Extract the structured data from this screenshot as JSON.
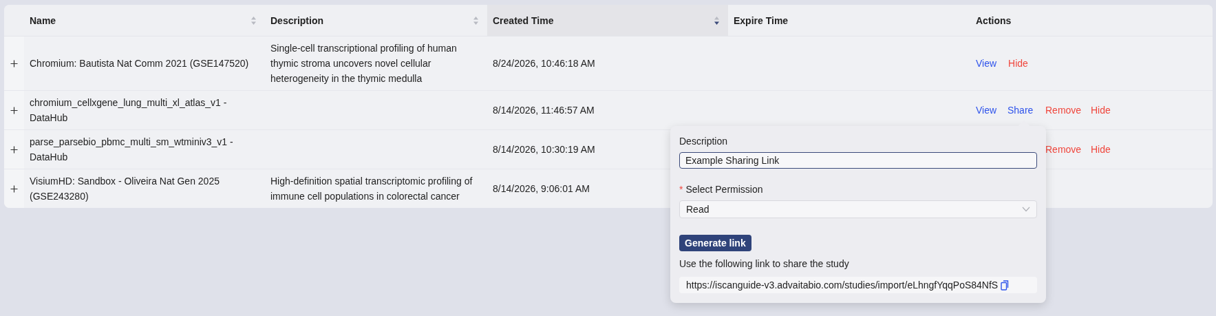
{
  "table": {
    "columns": [
      {
        "label": "Name",
        "sortable": true,
        "sorted": false
      },
      {
        "label": "Description",
        "sortable": true,
        "sorted": false
      },
      {
        "label": "Created Time",
        "sortable": true,
        "sorted": true
      },
      {
        "label": "Expire Time",
        "sortable": false,
        "sorted": false
      },
      {
        "label": "Actions",
        "sortable": false,
        "sorted": false
      }
    ],
    "rows": [
      {
        "name": "Chromium: Bautista Nat Comm 2021 (GSE147520)",
        "description": "Single-cell transcriptional profiling of human thymic stroma uncovers novel cellular heterogeneity in the thymic medulla",
        "created_time": "8/24/2026, 10:46:18 AM",
        "actions": [
          {
            "label": "View",
            "kind": "view"
          },
          {
            "label": "Hide",
            "kind": "hide"
          }
        ]
      },
      {
        "name": "chromium_cellxgene_lung_multi_xl_atlas_v1 - DataHub",
        "created_time": "8/14/2026, 11:46:57 AM",
        "actions": [
          {
            "label": "View",
            "kind": "view"
          },
          {
            "label": "Share",
            "kind": "share"
          },
          {
            "label": "Remove",
            "kind": "remove"
          },
          {
            "label": "Hide",
            "kind": "hide"
          }
        ]
      },
      {
        "name": "parse_parsebio_pbmc_multi_sm_wtminiv3_v1 - DataHub",
        "created_time": "8/14/2026, 10:30:19 AM",
        "actions": [
          {
            "label": "Remove",
            "kind": "remove"
          },
          {
            "label": "Hide",
            "kind": "hide"
          }
        ]
      },
      {
        "name": "VisiumHD: Sandbox - Oliveira Nat Gen 2025 (GSE243280)",
        "description": "High-definition spatial transcriptomic profiling of immune cell populations in colorectal cancer",
        "created_time": "8/14/2026, 9:06:01 AM",
        "actions": []
      }
    ]
  },
  "share_popover": {
    "description_label": "Description",
    "description_value": "Example Sharing Link",
    "required_mark": "*",
    "permission_label": "Select Permission",
    "permission_value": "Read",
    "generate_button": "Generate link",
    "hint": "Use the following link to share the study",
    "link": "https://iscanguide-v3.advaitabio.com/studies/import/eLhngfYqqPoS84NfS"
  }
}
